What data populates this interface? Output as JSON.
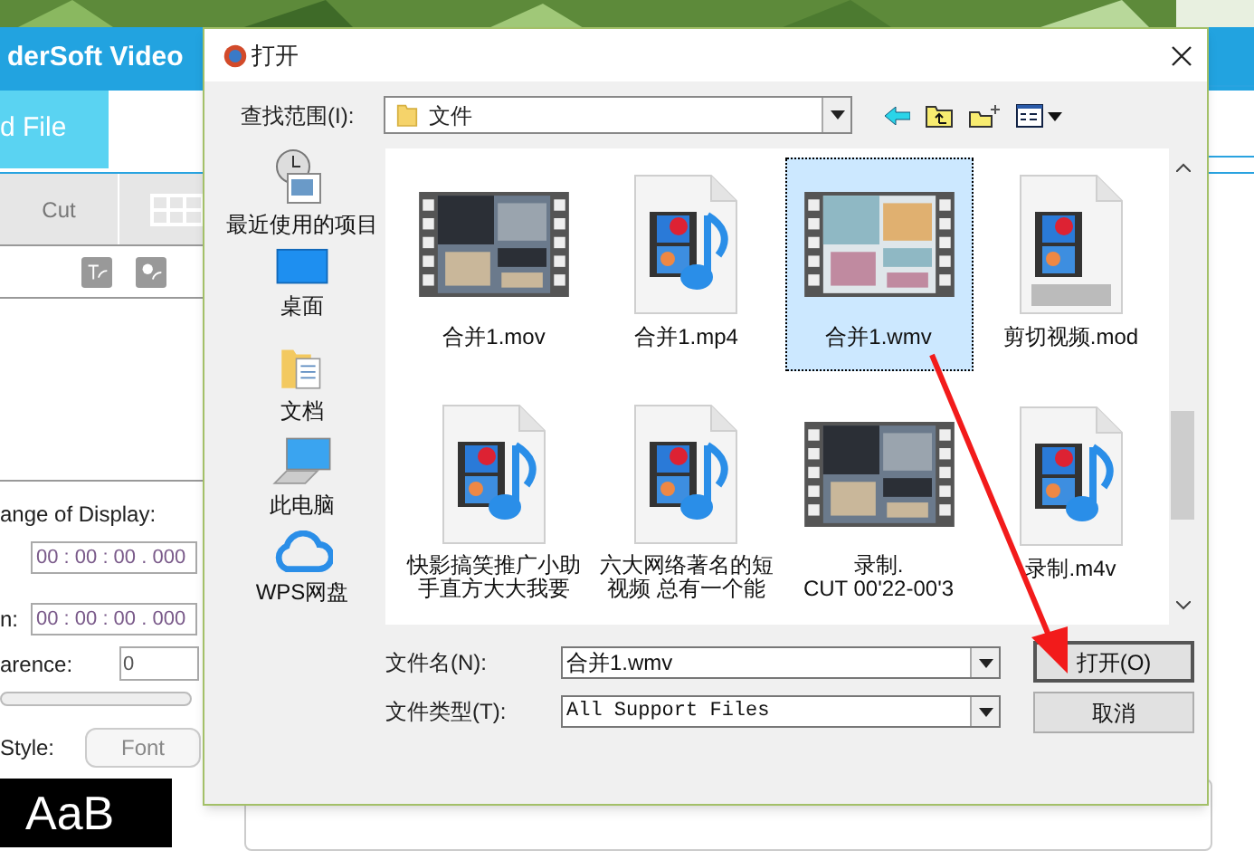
{
  "app": {
    "title": "derSoft Video",
    "add_file": "d File",
    "tabs": [
      {
        "label": "Cut",
        "selected": false
      }
    ],
    "display_label": "ange of Display:",
    "start_time": "00 : 00 : 00 . 000",
    "duration_label": "n:",
    "end_time": "00 : 00 : 00 . 000",
    "transparency_label": "arence:",
    "transparency": "0",
    "style_label": "Style:",
    "font_button": "Font",
    "preview": "AaB"
  },
  "dialog": {
    "title": "打开",
    "look_in_label": "查找范围(I):",
    "look_in": "文件",
    "places": [
      {
        "label": "最近使用的项目",
        "kind": "recent"
      },
      {
        "label": "桌面",
        "kind": "desktop"
      },
      {
        "label": "文档",
        "kind": "documents"
      },
      {
        "label": "此电脑",
        "kind": "computer"
      },
      {
        "label": "WPS网盘",
        "kind": "cloud"
      }
    ],
    "files": [
      {
        "name": "合并1.mov",
        "kind": "thumbnail",
        "selected": false
      },
      {
        "name": "合并1.mp4",
        "kind": "media",
        "selected": false
      },
      {
        "name": "合并1.wmv",
        "kind": "thumbnail",
        "selected": true
      },
      {
        "name": "剪切视频.mod",
        "kind": "mpeg",
        "selected": false
      },
      {
        "name": "快影搞笑推广小助手直方大大我要",
        "kind": "media",
        "selected": false
      },
      {
        "name": "六大网络著名的短视频 总有一个能",
        "kind": "media",
        "selected": false
      },
      {
        "name": "录制.\nCUT 00'22-00'3",
        "kind": "thumbnail",
        "selected": false
      },
      {
        "name": "录制.m4v",
        "kind": "media",
        "selected": false
      }
    ],
    "file_name_label": "文件名(N):",
    "file_name": "合并1.wmv",
    "file_type_label": "文件类型(T):",
    "file_type": "All Support Files",
    "buttons": [
      "打开(O)",
      "取消"
    ]
  }
}
